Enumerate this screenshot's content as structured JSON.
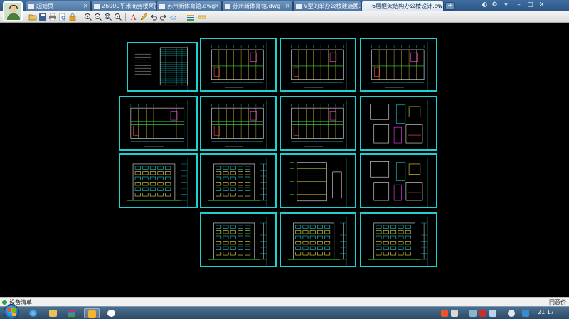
{
  "titlebar": {
    "tabs": [
      {
        "label": "起始页",
        "active": false
      },
      {
        "label": "26000平米商务楼平面...",
        "active": false
      },
      {
        "label": "苏州新体育馆.dwg",
        "active": false
      },
      {
        "label": "苏州新体育馆.dwg",
        "active": false
      },
      {
        "label": "V型的单办公楼建施图...",
        "active": false
      },
      {
        "label": "6层框架结构办公楼设计.dwg",
        "active": true
      }
    ],
    "new_tab": "+",
    "controls": {
      "minimize": "–",
      "maximize": "□",
      "close": "✕"
    }
  },
  "toolbar": {
    "buttons": [
      "open-icon",
      "save-icon",
      "print-icon",
      "print-preview-icon",
      "lock-icon",
      "zoom-in-icon",
      "zoom-out-icon",
      "zoom-window-icon",
      "zoom-extents-icon",
      "text-icon",
      "pencil-icon",
      "undo-icon",
      "redo-icon",
      "cloud-icon",
      "layer-icon",
      "measure-icon"
    ]
  },
  "drawing": {
    "line_color": "#1fd0d0",
    "sheets": [
      {
        "row": 1,
        "kind": "schedule"
      },
      {
        "row": 1,
        "kind": "plan"
      },
      {
        "row": 1,
        "kind": "plan"
      },
      {
        "row": 1,
        "kind": "plan"
      },
      {
        "row": 2,
        "kind": "plan"
      },
      {
        "row": 2,
        "kind": "plan"
      },
      {
        "row": 2,
        "kind": "plan"
      },
      {
        "row": 2,
        "kind": "details"
      },
      {
        "row": 3,
        "kind": "elevation"
      },
      {
        "row": 3,
        "kind": "elevation"
      },
      {
        "row": 3,
        "kind": "section"
      },
      {
        "row": 3,
        "kind": "details"
      },
      {
        "row": 4,
        "kind": "elevation"
      },
      {
        "row": 4,
        "kind": "elevation"
      },
      {
        "row": 4,
        "kind": "elevation"
      }
    ]
  },
  "statusbar": {
    "left_text": "设备清单",
    "right_text": "同意价"
  },
  "taskbar": {
    "apps": [
      "ie-icon",
      "explorer-icon",
      "winrar-icon",
      "cad-viewer-icon",
      "qq-icon"
    ],
    "tray": [
      "sogou-icon",
      "keyboard-icon",
      "network-icon",
      "flag-icon",
      "volume-icon",
      "cloud-icon",
      "chat-icon"
    ],
    "clock": "21:17"
  }
}
